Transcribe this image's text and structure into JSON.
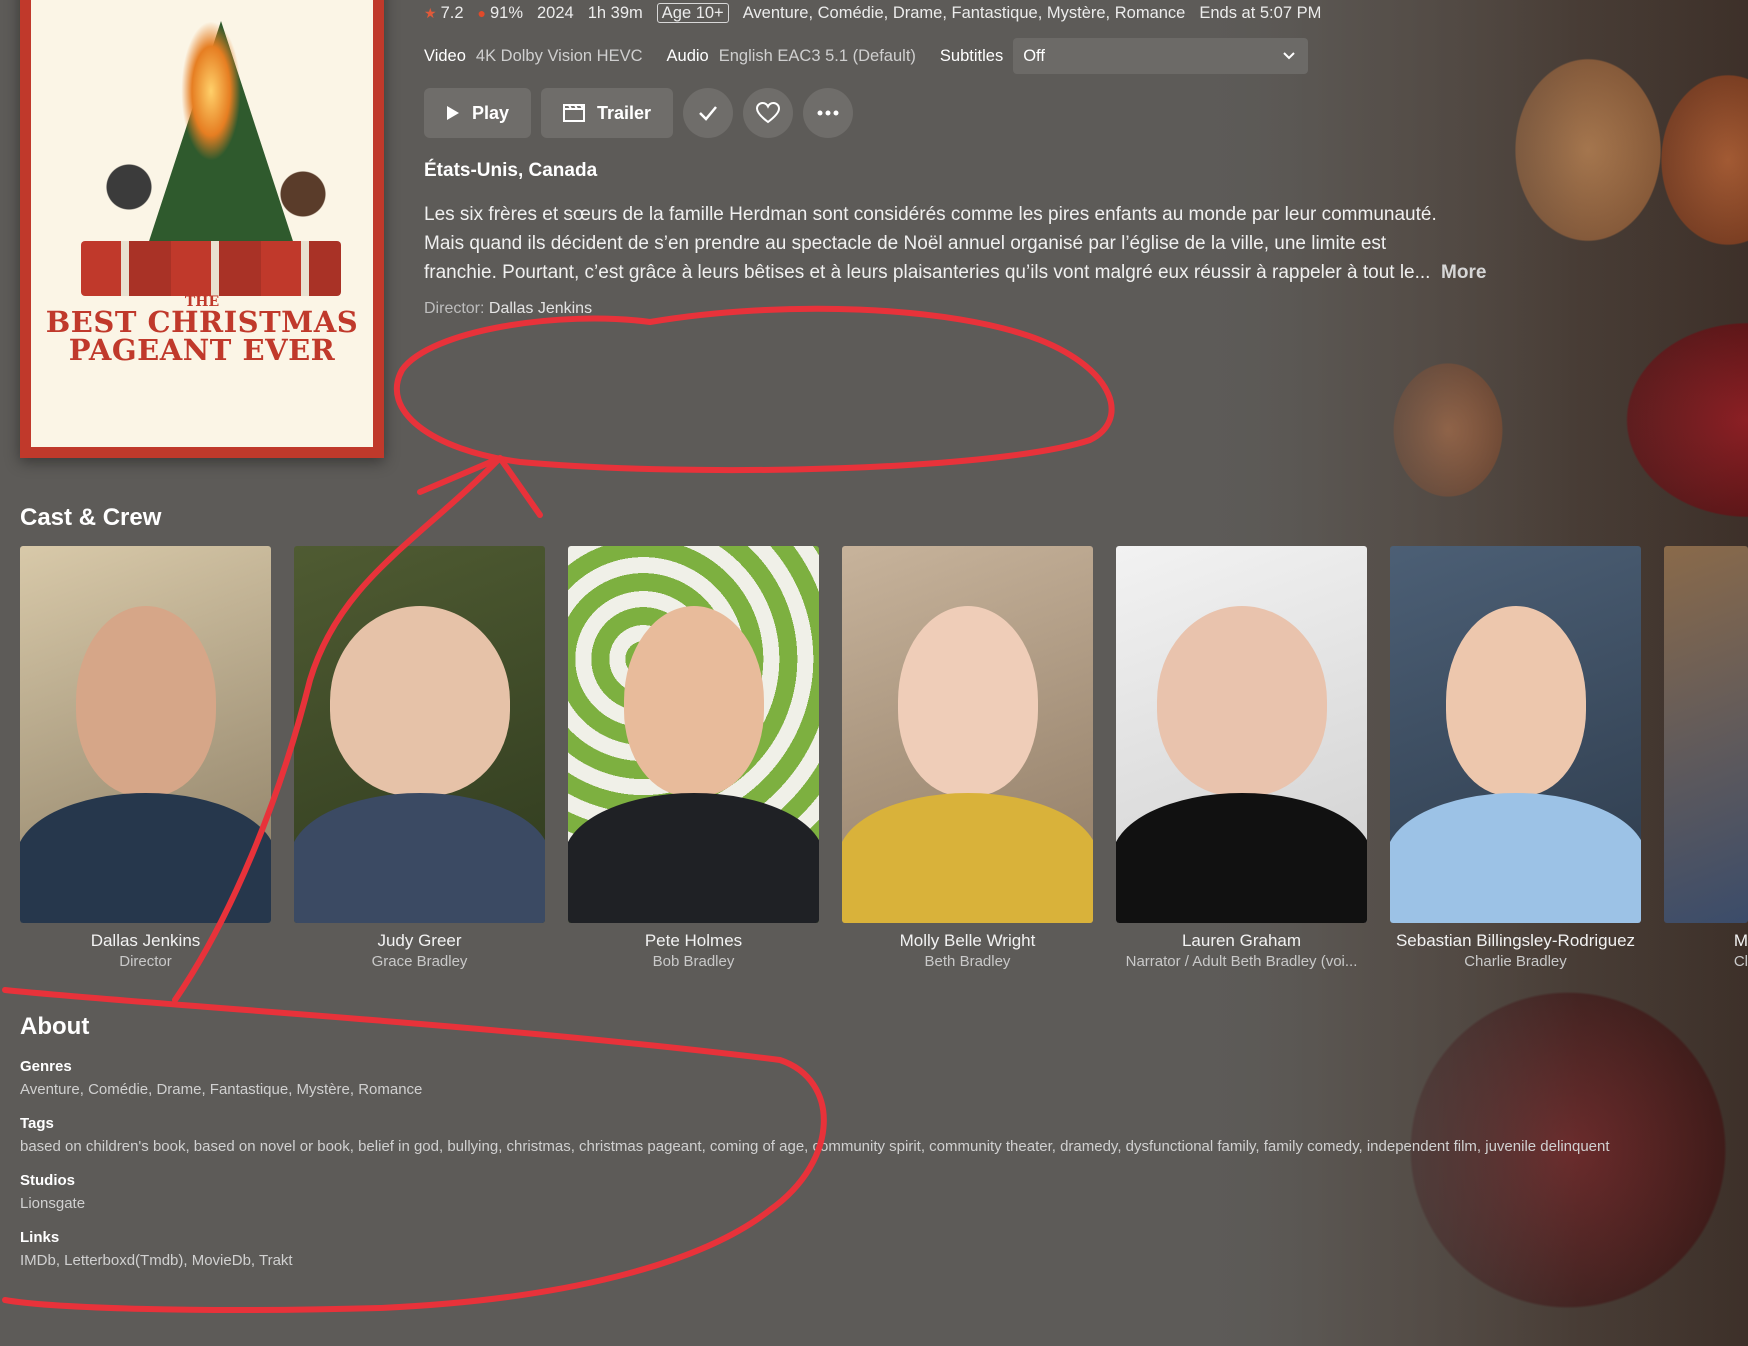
{
  "meta": {
    "rating": "7.2",
    "critic": "91%",
    "year": "2024",
    "runtime": "1h 39m",
    "age": "Age 10+",
    "genres": "Aventure, Comédie, Drame, Fantastique, Mystère, Romance",
    "ends": "Ends at 5:07 PM"
  },
  "streams": {
    "video_label": "Video",
    "video_value": "4K Dolby Vision HEVC",
    "audio_label": "Audio",
    "audio_value": "English EAC3 5.1 (Default)",
    "subtitles_label": "Subtitles",
    "subtitles_value": "Off"
  },
  "actions": {
    "play": "Play",
    "trailer": "Trailer"
  },
  "poster": {
    "the": "THE",
    "line1": "BEST CHRISTMAS",
    "line2": "PAGEANT EVER"
  },
  "country": "États-Unis, Canada",
  "overview": {
    "line1": "Les six frères et sœurs de la famille Herdman sont considérés comme les pires enfants au monde par leur communauté.",
    "line2": "Mais quand ils décident de s’en prendre au spectacle de Noël annuel organisé par l’église de la ville, une limite est",
    "line3": "franchie. Pourtant, c’est grâce à leurs bêtises et à leurs plaisanteries qu’ils vont malgré eux réussir à rappeler à tout le...",
    "more": "More"
  },
  "director": {
    "label": "Director:",
    "name": "Dallas Jenkins"
  },
  "cast_title": "Cast & Crew",
  "cast": [
    {
      "name": "Dallas Jenkins",
      "role": "Director"
    },
    {
      "name": "Judy Greer",
      "role": "Grace Bradley"
    },
    {
      "name": "Pete Holmes",
      "role": "Bob Bradley"
    },
    {
      "name": "Molly Belle Wright",
      "role": "Beth Bradley"
    },
    {
      "name": "Lauren Graham",
      "role": "Narrator / Adult Beth Bradley (voi..."
    },
    {
      "name": "Sebastian Billingsley-Rodriguez",
      "role": "Charlie Bradley"
    },
    {
      "name": "M",
      "role": "Cl"
    }
  ],
  "about": {
    "title": "About",
    "genres_label": "Genres",
    "genres": "Aventure, Comédie, Drame, Fantastique, Mystère, Romance",
    "tags_label": "Tags",
    "tags": "based on children's book, based on novel or book, belief in god, bullying, christmas, christmas pageant, coming of age, community spirit, community theater, dramedy, dysfunctional family, family comedy, independent film, juvenile delinquent",
    "studios_label": "Studios",
    "studios": "Lionsgate",
    "links_label": "Links",
    "links": "IMDb, Letterboxd(Tmdb), MovieDb, Trakt"
  },
  "colors": {
    "background": "#5d5b58",
    "button": "#6f6d6a",
    "annotation": "#e8323a",
    "poster_border": "#c0392b"
  }
}
